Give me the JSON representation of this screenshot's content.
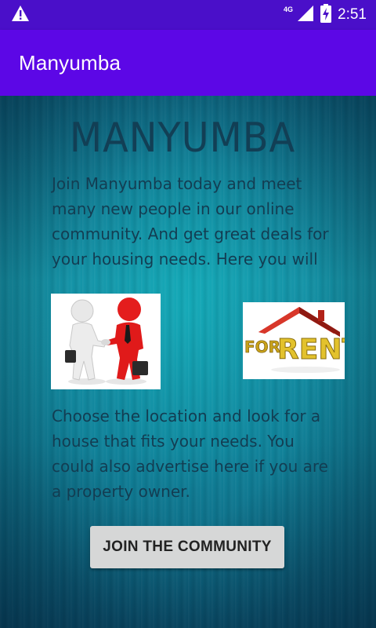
{
  "status_bar": {
    "network": "4G",
    "time": "2:51",
    "icons": [
      "warning-icon",
      "signal-icon",
      "battery-charging-icon"
    ]
  },
  "app_bar": {
    "title": "Manyumba"
  },
  "content": {
    "heading": "MANYUMBA",
    "paragraph1": "Join Manyumba today and meet many new people in our online community. And get great deals for your housing needs. Here you will",
    "paragraph2": "Choose the location and look for a house that fits your needs. You could also advertise here if you are a property owner.",
    "images": {
      "handshake": "handshake-image",
      "for_rent": "for-rent-image",
      "for_rent_text_for": "FOR",
      "for_rent_text_rent": "RENT"
    },
    "join_button_label": "JOIN THE COMMUNITY"
  },
  "colors": {
    "status_bar": "#4a0fc9",
    "app_bar": "#5c07e6",
    "background": "#0e6f86",
    "text": "#133d52",
    "button": "#d6d7d7"
  }
}
